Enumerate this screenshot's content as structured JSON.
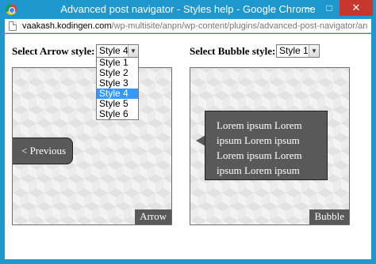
{
  "window": {
    "title": "Advanced post navigator - Styles help - Google Chrome",
    "minimize": "─",
    "maximize": "□",
    "close": "✕"
  },
  "address": {
    "host": "vaakash.kodingen.com",
    "path": "/wp-multisite/anpn/wp-content/plugins/advanced-post-navigator/anpn-preview"
  },
  "arrow_style": {
    "label": "Select Arrow style:",
    "selected": "Style 4",
    "options": [
      "Style 1",
      "Style 2",
      "Style 3",
      "Style 4",
      "Style 5",
      "Style 6"
    ],
    "highlighted_index": 3
  },
  "bubble_style": {
    "label": "Select Bubble style:",
    "selected": "Style 1"
  },
  "arrow_preview": {
    "button_label": "< Previous",
    "tag": "Arrow"
  },
  "bubble_preview": {
    "lines": [
      "Lorem ipsum Lorem",
      "ipsum Lorem ipsum",
      "Lorem ipsum Lorem",
      "ipsum Lorem ipsum"
    ],
    "tag": "Bubble"
  },
  "icons": {
    "app": "chrome-icon",
    "page": "page-icon",
    "dropdown": "chevron-down-icon"
  }
}
